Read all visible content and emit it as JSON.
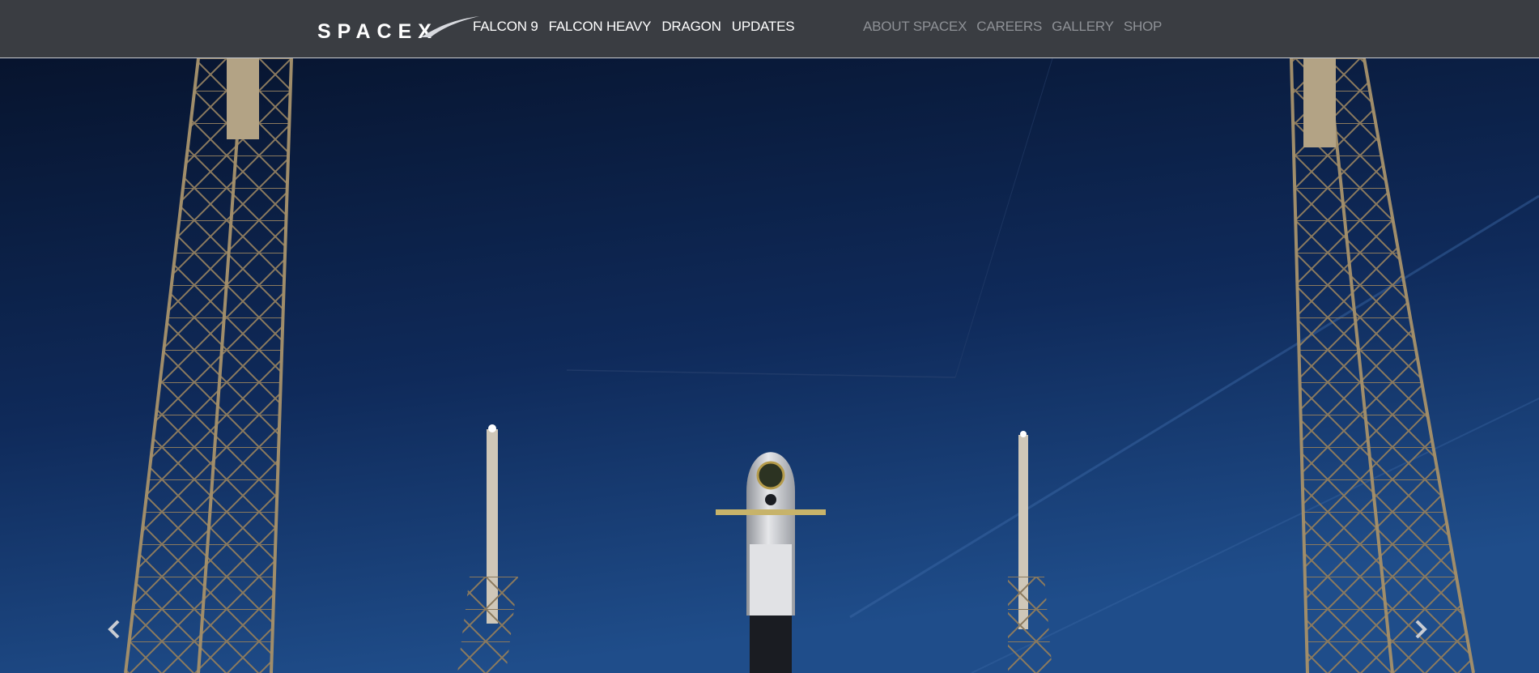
{
  "brand": {
    "logo_text": "SPACEX"
  },
  "nav_primary": [
    {
      "label": "FALCON 9"
    },
    {
      "label": "FALCON HEAVY"
    },
    {
      "label": "DRAGON"
    },
    {
      "label": "UPDATES"
    }
  ],
  "nav_secondary": [
    {
      "label": "ABOUT SPACEX"
    },
    {
      "label": "CAREERS"
    },
    {
      "label": "GALLERY"
    },
    {
      "label": "SHOP"
    }
  ],
  "carousel": {
    "prev_icon": "chevron-left-icon",
    "next_icon": "chevron-right-icon"
  },
  "colors": {
    "navbar_bg": "#3a3d42",
    "primary_link": "#ffffff",
    "secondary_link": "#8e9196",
    "sky_top": "#07142e",
    "sky_bottom": "#1d4a86"
  }
}
